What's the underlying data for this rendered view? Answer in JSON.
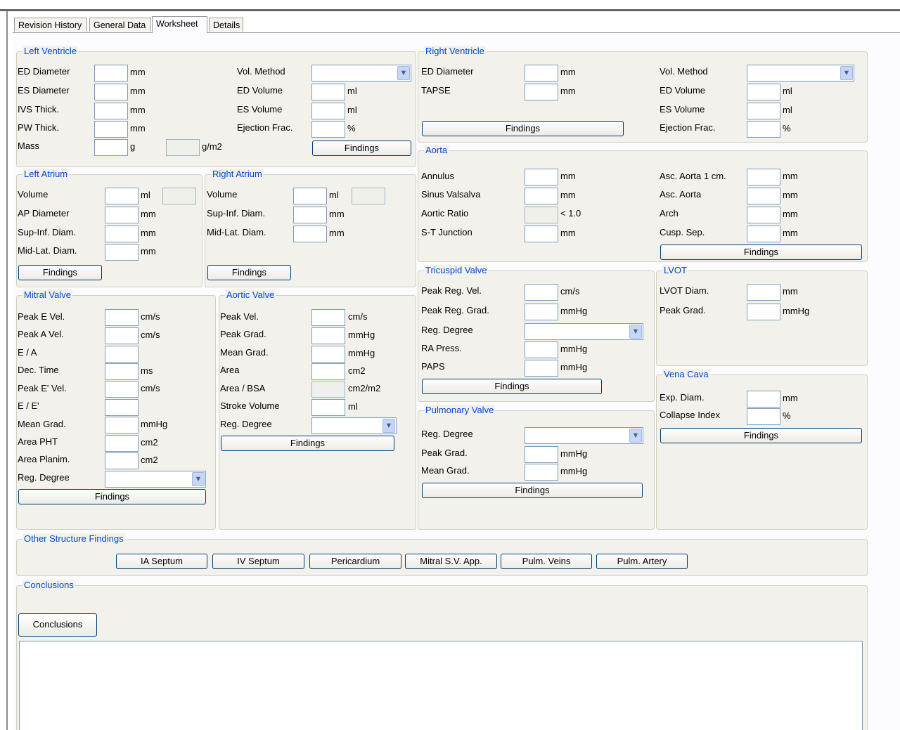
{
  "tabs": [
    "Revision History",
    "General Data",
    "Worksheet",
    "Details"
  ],
  "active_tab": "Worksheet",
  "findings_label": "Findings",
  "left_ventricle": {
    "title": "Left Ventricle",
    "ed_diameter": "ED Diameter",
    "es_diameter": "ES Diameter",
    "ivs_thick": "IVS Thick.",
    "pw_thick": "PW Thick.",
    "mass": "Mass",
    "vol_method": "Vol. Method",
    "ed_volume": "ED Volume",
    "es_volume": "ES Volume",
    "ejection_frac": "Ejection Frac.",
    "u_mm": "mm",
    "u_g": "g",
    "u_gm2": "g/m2",
    "u_ml": "ml",
    "u_pct": "%"
  },
  "right_ventricle": {
    "title": "Right Ventricle",
    "ed_diameter": "ED Diameter",
    "tapse": "TAPSE",
    "vol_method": "Vol. Method",
    "ed_volume": "ED Volume",
    "es_volume": "ES Volume",
    "ejection_frac": "Ejection Frac.",
    "u_mm": "mm",
    "u_ml": "ml",
    "u_pct": "%"
  },
  "left_atrium": {
    "title": "Left Atrium",
    "volume": "Volume",
    "ap_diameter": "AP Diameter",
    "sup_inf": "Sup-Inf. Diam.",
    "mid_lat": "Mid-Lat. Diam.",
    "u_ml": "ml",
    "u_mm": "mm"
  },
  "right_atrium": {
    "title": "Right Atrium",
    "volume": "Volume",
    "sup_inf": "Sup-Inf. Diam.",
    "mid_lat": "Mid-Lat. Diam.",
    "u_ml": "ml",
    "u_mm": "mm"
  },
  "aorta": {
    "title": "Aorta",
    "annulus": "Annulus",
    "sinus_valsalva": "Sinus Valsalva",
    "aortic_ratio": "Aortic Ratio",
    "st_junction": "S-T Junction",
    "asc_aorta_1cm": "Asc. Aorta 1 cm.",
    "asc_aorta": "Asc. Aorta",
    "arch": "Arch",
    "cusp_sep": "Cusp. Sep.",
    "u_mm": "mm",
    "ratio_ref": "< 1.0"
  },
  "mitral_valve": {
    "title": "Mitral Valve",
    "peak_e": "Peak E Vel.",
    "peak_a": "Peak A Vel.",
    "e_a": "E / A",
    "dec_time": "Dec. Time",
    "peak_e_prime": "Peak E' Vel.",
    "e_e_prime": "E / E'",
    "mean_grad": "Mean Grad.",
    "area_pht": "Area PHT",
    "area_planim": "Area Planim.",
    "reg_degree": "Reg. Degree",
    "u_cms": "cm/s",
    "u_ms": "ms",
    "u_mmhg": "mmHg",
    "u_cm2": "cm2"
  },
  "aortic_valve": {
    "title": "Aortic Valve",
    "peak_vel": "Peak Vel.",
    "peak_grad": "Peak Grad.",
    "mean_grad": "Mean Grad.",
    "area": "Area",
    "area_bsa": "Area / BSA",
    "stroke_volume": "Stroke Volume",
    "reg_degree": "Reg. Degree",
    "u_cms": "cm/s",
    "u_mmhg": "mmHg",
    "u_cm2": "cm2",
    "u_cm2m2": "cm2/m2",
    "u_ml": "ml"
  },
  "tricuspid_valve": {
    "title": "Tricuspid Valve",
    "peak_reg_vel": "Peak Reg. Vel.",
    "peak_reg_grad": "Peak Reg. Grad.",
    "reg_degree": "Reg. Degree",
    "ra_press": "RA Press.",
    "paps": "PAPS",
    "u_cms": "cm/s",
    "u_mmhg": "mmHg"
  },
  "lvot": {
    "title": "LVOT",
    "lvot_diam": "LVOT Diam.",
    "peak_grad": "Peak Grad.",
    "u_mm": "mm",
    "u_mmhg": "mmHg"
  },
  "pulmonary_valve": {
    "title": "Pulmonary Valve",
    "reg_degree": "Reg. Degree",
    "peak_grad": "Peak Grad.",
    "mean_grad": "Mean Grad.",
    "u_mmhg": "mmHg"
  },
  "vena_cava": {
    "title": "Vena Cava",
    "exp_diam": "Exp. Diam.",
    "collapse_index": "Collapse Index",
    "u_mm": "mm",
    "u_pct": "%"
  },
  "other_structure": {
    "title": "Other Structure Findings",
    "buttons": [
      "IA Septum",
      "IV Septum",
      "Pericardium",
      "Mitral S.V. App.",
      "Pulm. Veins",
      "Pulm. Artery"
    ]
  },
  "conclusions": {
    "title": "Conclusions",
    "button": "Conclusions"
  }
}
